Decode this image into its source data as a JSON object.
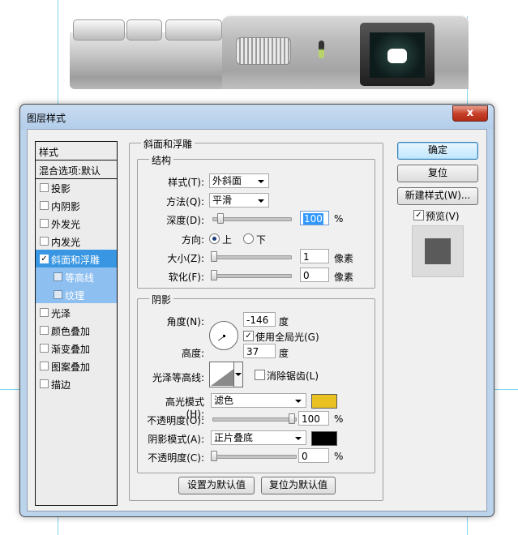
{
  "window": {
    "title": "图层样式",
    "close_label": "x"
  },
  "style_list": {
    "header": "样式",
    "blend_options": "混合选项:默认",
    "items": [
      {
        "label": "投影",
        "checked": false
      },
      {
        "label": "内阴影",
        "checked": false
      },
      {
        "label": "外发光",
        "checked": false
      },
      {
        "label": "内发光",
        "checked": false
      },
      {
        "label": "斜面和浮雕",
        "checked": true
      },
      {
        "label": "等高线",
        "checked": false
      },
      {
        "label": "纹理",
        "checked": false
      },
      {
        "label": "光泽",
        "checked": false
      },
      {
        "label": "颜色叠加",
        "checked": false
      },
      {
        "label": "渐变叠加",
        "checked": false
      },
      {
        "label": "图案叠加",
        "checked": false
      },
      {
        "label": "描边",
        "checked": false
      }
    ]
  },
  "bevel": {
    "section_title": "斜面和浮雕",
    "structure_title": "结构",
    "style_label": "样式(T):",
    "style_value": "外斜面",
    "technique_label": "方法(Q):",
    "technique_value": "平滑",
    "depth_label": "深度(D):",
    "depth_value": "100",
    "depth_unit": "%",
    "direction_label": "方向:",
    "direction_up": "上",
    "direction_down": "下",
    "size_label": "大小(Z):",
    "size_value": "1",
    "size_unit": "像素",
    "soften_label": "软化(F):",
    "soften_value": "0",
    "soften_unit": "像素"
  },
  "shading": {
    "title": "阴影",
    "angle_label": "角度(N):",
    "angle_value": "-146",
    "angle_unit": "度",
    "global_light_label": "使用全局光(G)",
    "altitude_label": "高度:",
    "altitude_value": "37",
    "altitude_unit": "度",
    "gloss_contour_label": "光泽等高线:",
    "anti_alias_label": "消除锯齿(L)",
    "highlight_mode_label": "高光模式(H):",
    "highlight_mode_value": "滤色",
    "highlight_color": "#e8c021",
    "highlight_opacity_label": "不透明度(O):",
    "highlight_opacity_value": "100",
    "highlight_opacity_unit": "%",
    "shadow_mode_label": "阴影模式(A):",
    "shadow_mode_value": "正片叠底",
    "shadow_color": "#000000",
    "shadow_opacity_label": "不透明度(C):",
    "shadow_opacity_value": "0",
    "shadow_opacity_unit": "%"
  },
  "footer": {
    "make_default": "设置为默认值",
    "reset_default": "复位为默认值"
  },
  "side": {
    "ok": "确定",
    "reset": "复位",
    "new_style": "新建样式(W)...",
    "preview_label": "预览(V)"
  }
}
